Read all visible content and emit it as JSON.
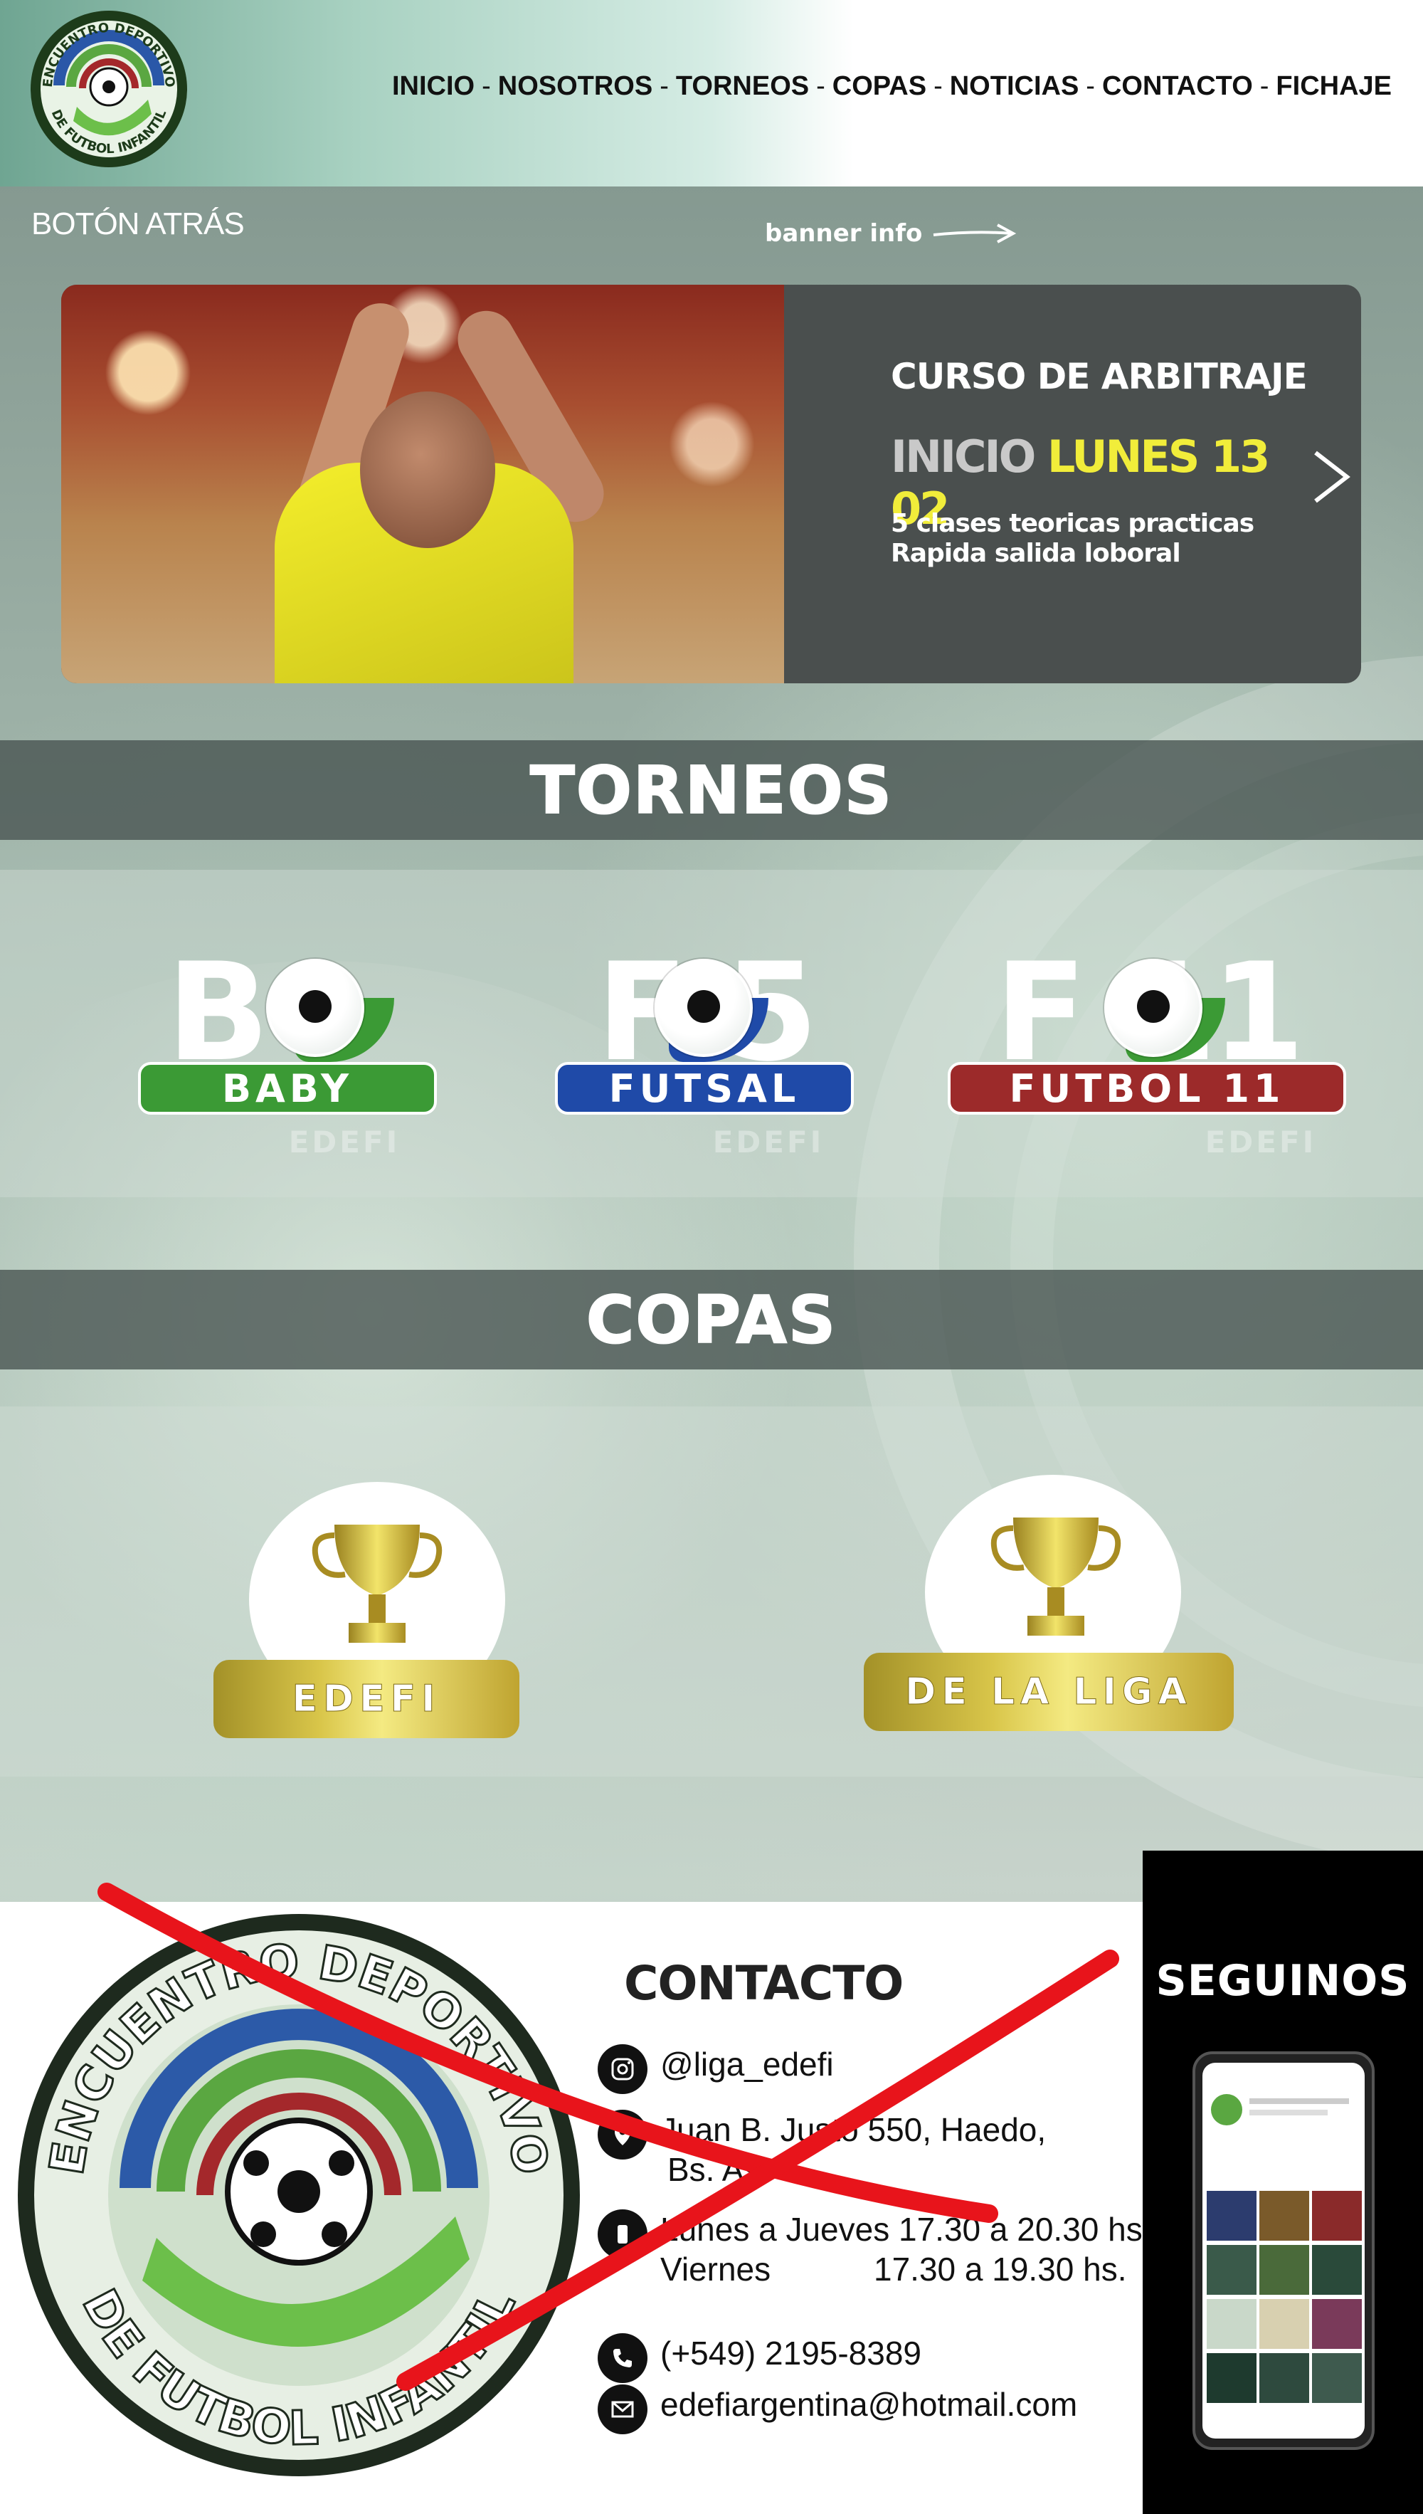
{
  "nav": {
    "items": [
      "INICIO",
      "NOSOTROS",
      "TORNEOS",
      "COPAS",
      "NOTICIAS",
      "CONTACTO",
      "FICHAJE"
    ],
    "separator": "-"
  },
  "back_button": "BOTÓN ATRÁS",
  "banner_info": "banner info",
  "banner": {
    "title": "CURSO DE ARBITRAJE",
    "start_label": "INICIO",
    "start_date": "LUNES 13 02",
    "desc_line1": "5 clases teoricas practicas",
    "desc_line2": "Rapida  salida loboral"
  },
  "torneos": {
    "title": "TORNEOS",
    "items": [
      {
        "big": "B",
        "label": "BABY",
        "watermark": "EDEFI",
        "color": "#3b9a35"
      },
      {
        "big": "F 5",
        "label": "FUTSAL",
        "watermark": "EDEFI",
        "color": "#1f4aa8"
      },
      {
        "big": "F 11",
        "label": "FUTBOL  11",
        "watermark": "EDEFI",
        "color": "#9c2a2a"
      }
    ]
  },
  "copas": {
    "title": "COPAS",
    "items": [
      {
        "label": "EDEFI"
      },
      {
        "label": "DE LA LIGA"
      }
    ]
  },
  "contact": {
    "title": "CONTACTO",
    "instagram": "@liga_edefi",
    "address_line1": "Juan B. Justo 550, Haedo,",
    "address_line2": "Bs. As.",
    "hours_line1": "Lunes a Jueves 17.30 a 20.30 hs.",
    "hours_line2_day": "Viernes",
    "hours_line2_time": "17.30 a 19.30 hs.",
    "phone": "(+549) 2195-8389",
    "email": "edefiargentina@hotmail.com"
  },
  "follow": {
    "title": "SEGUINOS"
  },
  "logo_text": {
    "top": "ENCUENTRO DEPORTIVO",
    "bottom": "DE FUTBOL INFANTIL"
  },
  "colors": {
    "accent_yellow": "#f1ed3a",
    "cross_red": "#e8141b"
  }
}
